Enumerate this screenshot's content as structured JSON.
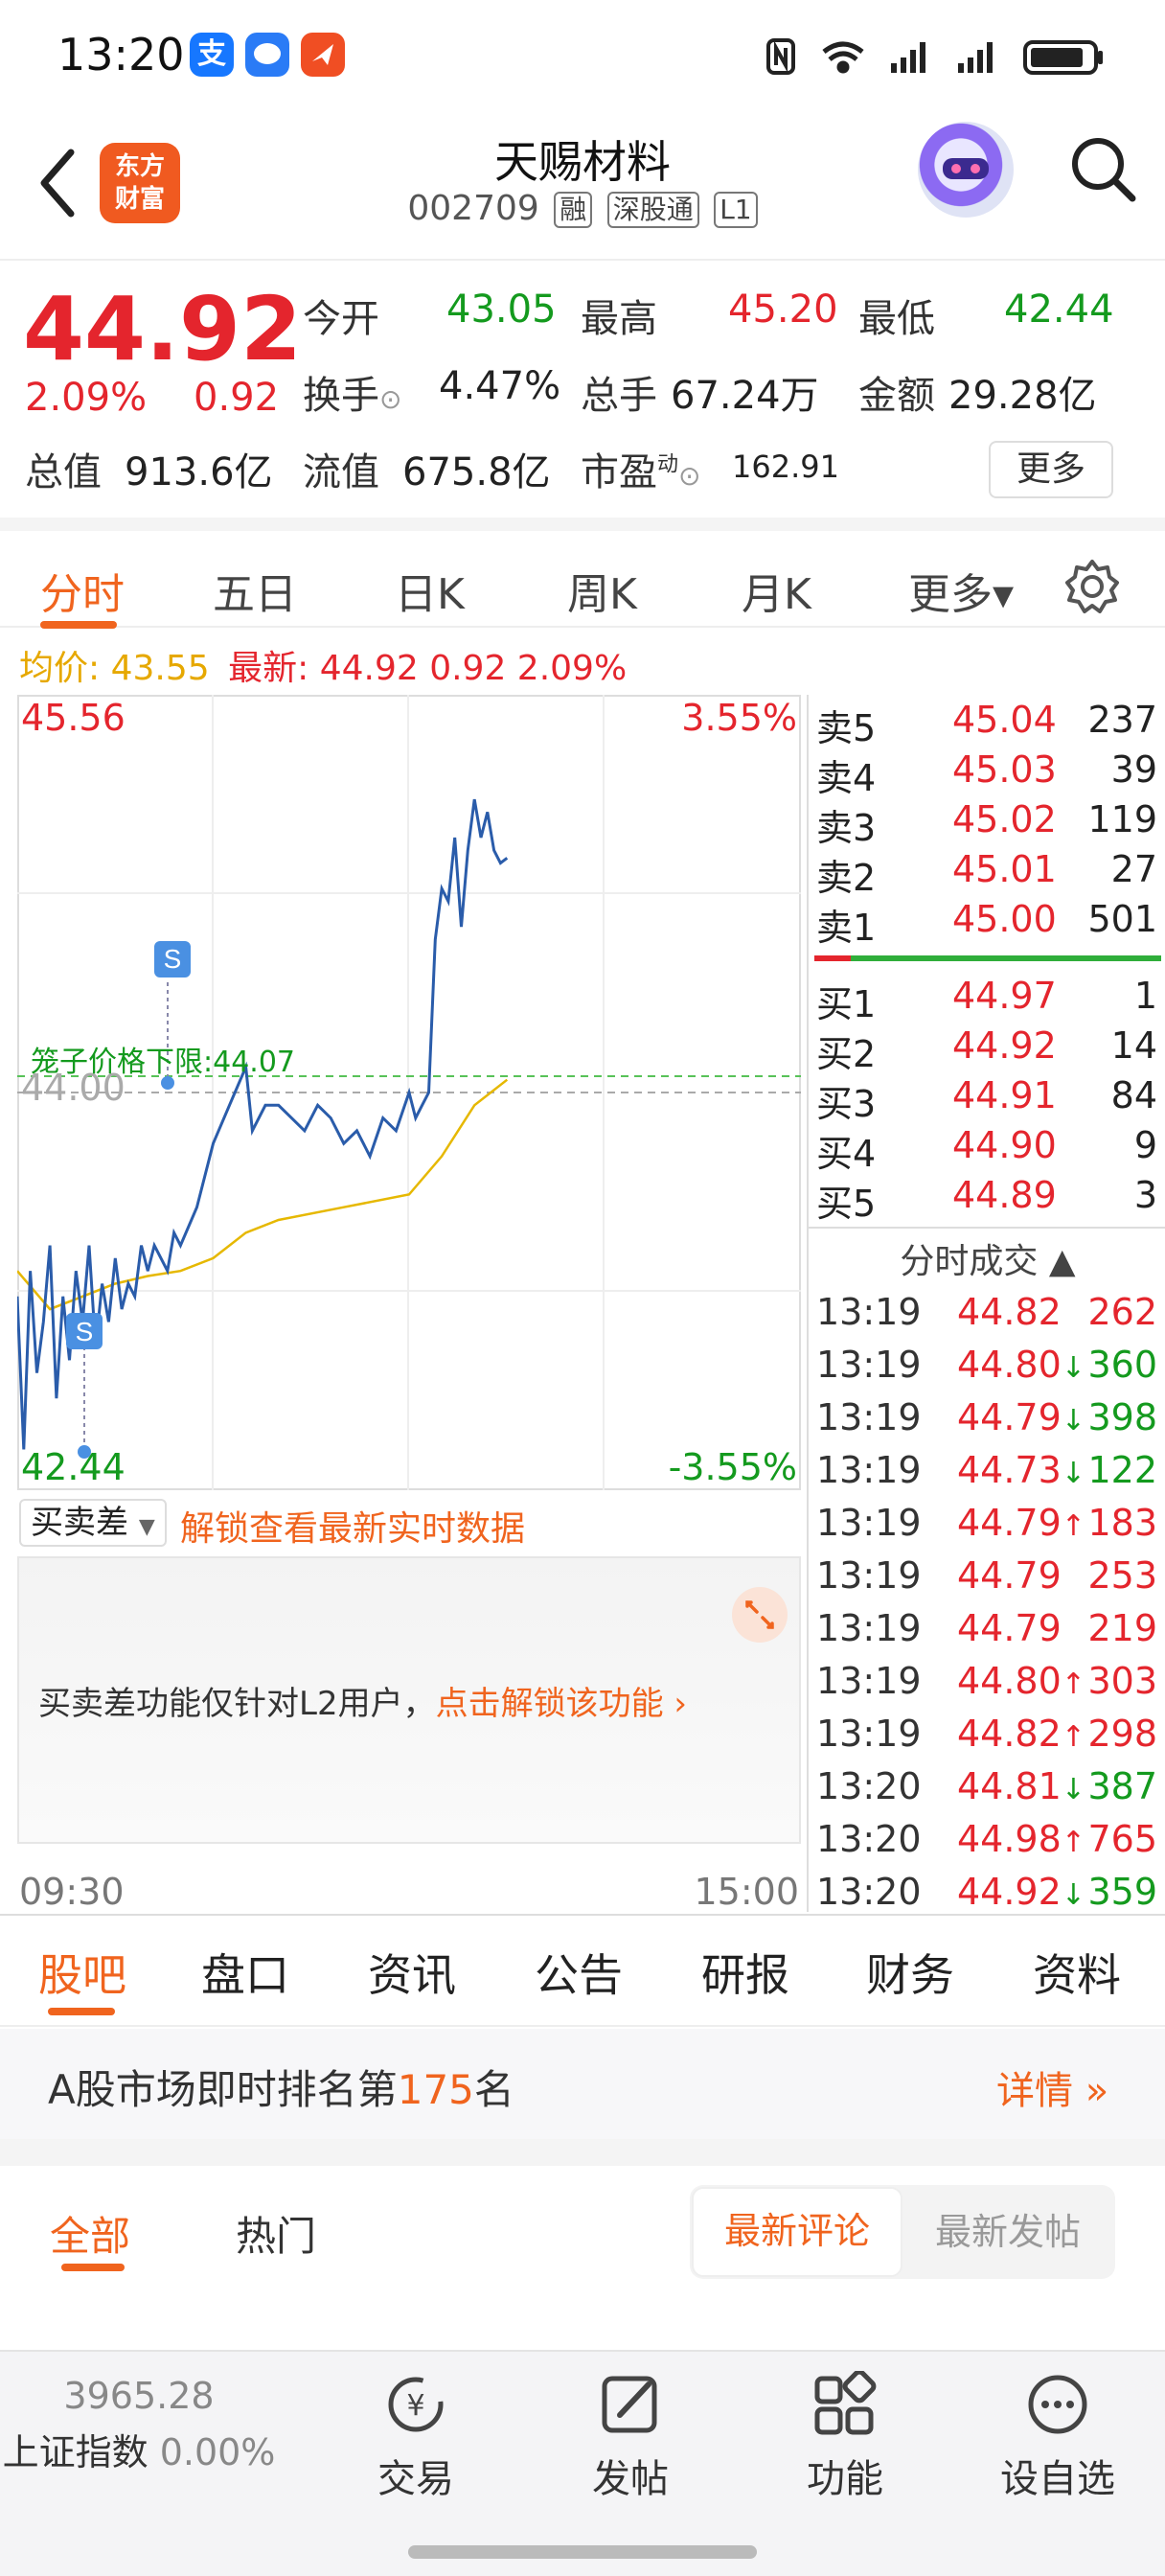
{
  "status_bar": {
    "time": "13:20",
    "apps": [
      "支",
      "",
      ""
    ],
    "icons": [
      "nfc-icon",
      "wifi-icon",
      "signal-icon",
      "signal-icon",
      "battery-icon"
    ]
  },
  "header": {
    "logo": "东方\n财富",
    "title": "天赐材料",
    "code": "002709",
    "tags": [
      "融",
      "深股通",
      "L1"
    ]
  },
  "quote": {
    "price": "44.92",
    "change_pct": "2.09%",
    "change": "0.92",
    "fields": [
      {
        "label": "今开",
        "value": "43.05",
        "color": "green"
      },
      {
        "label": "最高",
        "value": "45.20",
        "color": "red"
      },
      {
        "label": "最低",
        "value": "42.44",
        "color": "green"
      },
      {
        "label": "换手",
        "value": "4.47%",
        "color": "black"
      },
      {
        "label": "总手",
        "value": "67.24万",
        "color": "black"
      },
      {
        "label": "金额",
        "value": "29.28亿",
        "color": "black"
      },
      {
        "label": "总值",
        "value": "913.6亿",
        "color": "black"
      },
      {
        "label": "流值",
        "value": "675.8亿",
        "color": "black"
      },
      {
        "label": "市盈",
        "value": "162.91",
        "color": "black"
      }
    ],
    "pe_sup": "动",
    "more": "更多"
  },
  "period_tabs": [
    "分时",
    "五日",
    "日K",
    "周K",
    "月K",
    "更多▾"
  ],
  "info_line": {
    "avg_label": "均价:",
    "avg": "43.55",
    "latest_label": "最新:",
    "latest": "44.92 0.92 2.09%"
  },
  "chart": {
    "top_price": "45.56",
    "top_pct": "3.55%",
    "bottom_price": "42.44",
    "bottom_pct": "-3.55%",
    "mid_price": "44.00",
    "limit_label": "笼子价格下限:44.07",
    "marker": "S",
    "time_start": "09:30",
    "time_end": "15:00"
  },
  "chart_data": {
    "type": "line",
    "ylim": [
      42.44,
      45.56
    ],
    "xlim": [
      0,
      240
    ],
    "series": [
      {
        "values": [
          [
            0,
            43.2
          ],
          [
            2,
            42.6
          ],
          [
            4,
            43.3
          ],
          [
            6,
            42.9
          ],
          [
            8,
            43.1
          ],
          [
            10,
            43.4
          ],
          [
            12,
            42.8
          ],
          [
            14,
            43.2
          ],
          [
            16,
            42.95
          ],
          [
            18,
            43.3
          ],
          [
            20,
            43.1
          ],
          [
            22,
            43.4
          ],
          [
            24,
            43.0
          ],
          [
            26,
            43.25
          ],
          [
            28,
            43.1
          ],
          [
            30,
            43.35
          ],
          [
            32,
            43.15
          ],
          [
            34,
            43.25
          ],
          [
            36,
            43.2
          ],
          [
            38,
            43.4
          ],
          [
            40,
            43.3
          ],
          [
            42,
            43.4
          ],
          [
            44,
            43.35
          ],
          [
            46,
            43.3
          ],
          [
            48,
            43.45
          ],
          [
            50,
            43.4
          ],
          [
            55,
            43.55
          ],
          [
            60,
            43.8
          ],
          [
            65,
            43.95
          ],
          [
            70,
            44.1
          ],
          [
            72,
            43.85
          ],
          [
            76,
            43.95
          ],
          [
            80,
            43.95
          ],
          [
            84,
            43.9
          ],
          [
            88,
            43.85
          ],
          [
            92,
            43.95
          ],
          [
            96,
            43.9
          ],
          [
            100,
            43.8
          ],
          [
            104,
            43.85
          ],
          [
            108,
            43.75
          ],
          [
            112,
            43.9
          ],
          [
            116,
            43.85
          ],
          [
            120,
            44.0
          ],
          [
            122,
            43.9
          ],
          [
            124,
            43.95
          ],
          [
            126,
            44.0
          ],
          [
            128,
            44.6
          ],
          [
            130,
            44.8
          ],
          [
            132,
            44.75
          ],
          [
            134,
            45.0
          ],
          [
            136,
            44.65
          ],
          [
            138,
            44.95
          ],
          [
            140,
            45.15
          ],
          [
            142,
            45.0
          ],
          [
            144,
            45.1
          ],
          [
            146,
            44.95
          ],
          [
            148,
            44.9
          ],
          [
            150,
            44.92
          ]
        ]
      },
      {
        "values": [
          [
            0,
            43.3
          ],
          [
            10,
            43.15
          ],
          [
            20,
            43.2
          ],
          [
            30,
            43.25
          ],
          [
            40,
            43.28
          ],
          [
            50,
            43.3
          ],
          [
            60,
            43.35
          ],
          [
            70,
            43.45
          ],
          [
            80,
            43.5
          ],
          [
            100,
            43.55
          ],
          [
            120,
            43.6
          ],
          [
            130,
            43.75
          ],
          [
            140,
            43.95
          ],
          [
            150,
            44.05
          ]
        ]
      }
    ]
  },
  "order_book": {
    "sells": [
      {
        "label": "卖5",
        "price": "45.04",
        "vol": "237"
      },
      {
        "label": "卖4",
        "price": "45.03",
        "vol": "39"
      },
      {
        "label": "卖3",
        "price": "45.02",
        "vol": "119"
      },
      {
        "label": "卖2",
        "price": "45.01",
        "vol": "27"
      },
      {
        "label": "卖1",
        "price": "45.00",
        "vol": "501"
      }
    ],
    "buys": [
      {
        "label": "买1",
        "price": "44.97",
        "vol": "1"
      },
      {
        "label": "买2",
        "price": "44.92",
        "vol": "14"
      },
      {
        "label": "买3",
        "price": "44.91",
        "vol": "84"
      },
      {
        "label": "买4",
        "price": "44.90",
        "vol": "9"
      },
      {
        "label": "买5",
        "price": "44.89",
        "vol": "3"
      }
    ],
    "ticks_title": "分时成交 ▲"
  },
  "ticks": [
    {
      "time": "13:19",
      "price": "44.82",
      "arrow": "",
      "vol": "262",
      "color": "red"
    },
    {
      "time": "13:19",
      "price": "44.80",
      "arrow": "↓",
      "vol": "360",
      "color": "green"
    },
    {
      "time": "13:19",
      "price": "44.79",
      "arrow": "↓",
      "vol": "398",
      "color": "green"
    },
    {
      "time": "13:19",
      "price": "44.73",
      "arrow": "↓",
      "vol": "122",
      "color": "green"
    },
    {
      "time": "13:19",
      "price": "44.79",
      "arrow": "↑",
      "vol": "183",
      "color": "red"
    },
    {
      "time": "13:19",
      "price": "44.79",
      "arrow": "",
      "vol": "253",
      "color": "red"
    },
    {
      "time": "13:19",
      "price": "44.79",
      "arrow": "",
      "vol": "219",
      "color": "red"
    },
    {
      "time": "13:19",
      "price": "44.80",
      "arrow": "↑",
      "vol": "303",
      "color": "red"
    },
    {
      "time": "13:19",
      "price": "44.82",
      "arrow": "↑",
      "vol": "298",
      "color": "red"
    },
    {
      "time": "13:20",
      "price": "44.81",
      "arrow": "↓",
      "vol": "387",
      "color": "green"
    },
    {
      "time": "13:20",
      "price": "44.98",
      "arrow": "↑",
      "vol": "765",
      "color": "red"
    },
    {
      "time": "13:20",
      "price": "44.92",
      "arrow": "↓",
      "vol": "359",
      "color": "green"
    }
  ],
  "lower_panel": {
    "dropdown": "买卖差",
    "unlock_text": "解锁查看最新实时数据",
    "notice": "买卖差功能仅针对L2用户，",
    "notice_link": "点击解锁该功能 ›"
  },
  "bottom_tabs": [
    "股吧",
    "盘口",
    "资讯",
    "公告",
    "研报",
    "财务",
    "资料"
  ],
  "rank": {
    "prefix": "A股市场即时排名第",
    "number": "175",
    "suffix": "名",
    "detail": "详情 »"
  },
  "forum": {
    "tabs": [
      "全部",
      "热门"
    ],
    "sort": [
      "最新评论",
      "最新发帖"
    ]
  },
  "bottom_nav": {
    "index_value": "3965.28",
    "index_name": "上证指数",
    "index_change": "0.00%",
    "items": [
      "交易",
      "发帖",
      "功能",
      "设自选"
    ]
  }
}
